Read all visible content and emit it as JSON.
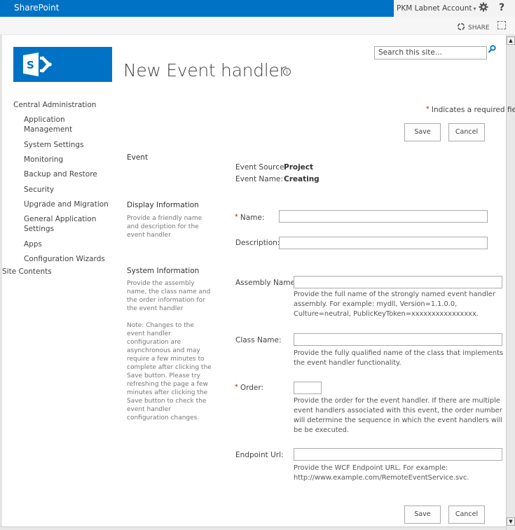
{
  "suitebar": {
    "brand": "SharePoint",
    "account": "PKM Labnet Account",
    "account_caret": "▾",
    "settings_icon": "gear-icon",
    "help_label": "?"
  },
  "ribbon": {
    "share_label": "SHARE",
    "share_icon": "share-icon",
    "focus_icon": "focus-mode-icon"
  },
  "header": {
    "logo": "sharepoint-logo",
    "title": "New Event handler",
    "info_icon": "ⓘ"
  },
  "search": {
    "placeholder": "Search this site..."
  },
  "nav": {
    "root": "Central Administration",
    "items": [
      {
        "label": "Application Management"
      },
      {
        "label": "System Settings"
      },
      {
        "label": "Monitoring"
      },
      {
        "label": "Backup and Restore"
      },
      {
        "label": "Security"
      },
      {
        "label": "Upgrade and Migration"
      },
      {
        "label": "General Application Settings"
      },
      {
        "label": "Apps"
      },
      {
        "label": "Configuration Wizards"
      }
    ],
    "site_contents": "Site Contents"
  },
  "form": {
    "required_star": "*",
    "required_note": "Indicates a required fiel",
    "save_label": "Save",
    "cancel_label": "Cancel",
    "sections": {
      "event": {
        "title": "Event",
        "source_label": "Event Source:",
        "source_value": "Project",
        "name_label": "Event Name:",
        "name_value": "Creating"
      },
      "display": {
        "title": "Display Information",
        "description": "Provide a friendly name and description for the event handler",
        "name_label": "Name:",
        "name_value": "",
        "description_label": "Description:",
        "description_value": ""
      },
      "system": {
        "title": "System Information",
        "description": "Provide the assembly name, the class name and the order information for the event handler",
        "note": "Note: Changes to the event handler configuration are asynchronous and may require a few minutes to complete after clicking the Save button. Please try refreshing the page a few minutes after clicking the Save button to check the event handler configuration changes.",
        "assembly_label": "Assembly Name:",
        "assembly_value": "",
        "assembly_help": "Provide the full name of the strongly named event handler assembly. For example: mydll, Version=1.1.0.0, Culture=neutral, PublicKeyToken=xxxxxxxxxxxxxxxx.",
        "class_label": "Class Name:",
        "class_value": "",
        "class_help": "Provide the fully qualified name of the class that implements the event handler functionality.",
        "order_label": "Order:",
        "order_value": "",
        "order_help": "Provide the order for the event handler. If there are multiple event handlers associated with this event, the order number will determine the sequence in which the event handlers will be be executed.",
        "endpoint_label": "Endpoint Url:",
        "endpoint_value": "",
        "endpoint_help": "Provide the WCF Endpoint URL. For example: http://www.example.com/RemoteEventService.svc."
      }
    }
  },
  "colors": {
    "brand_blue": "#0072c6",
    "required_red": "#bf0000"
  }
}
